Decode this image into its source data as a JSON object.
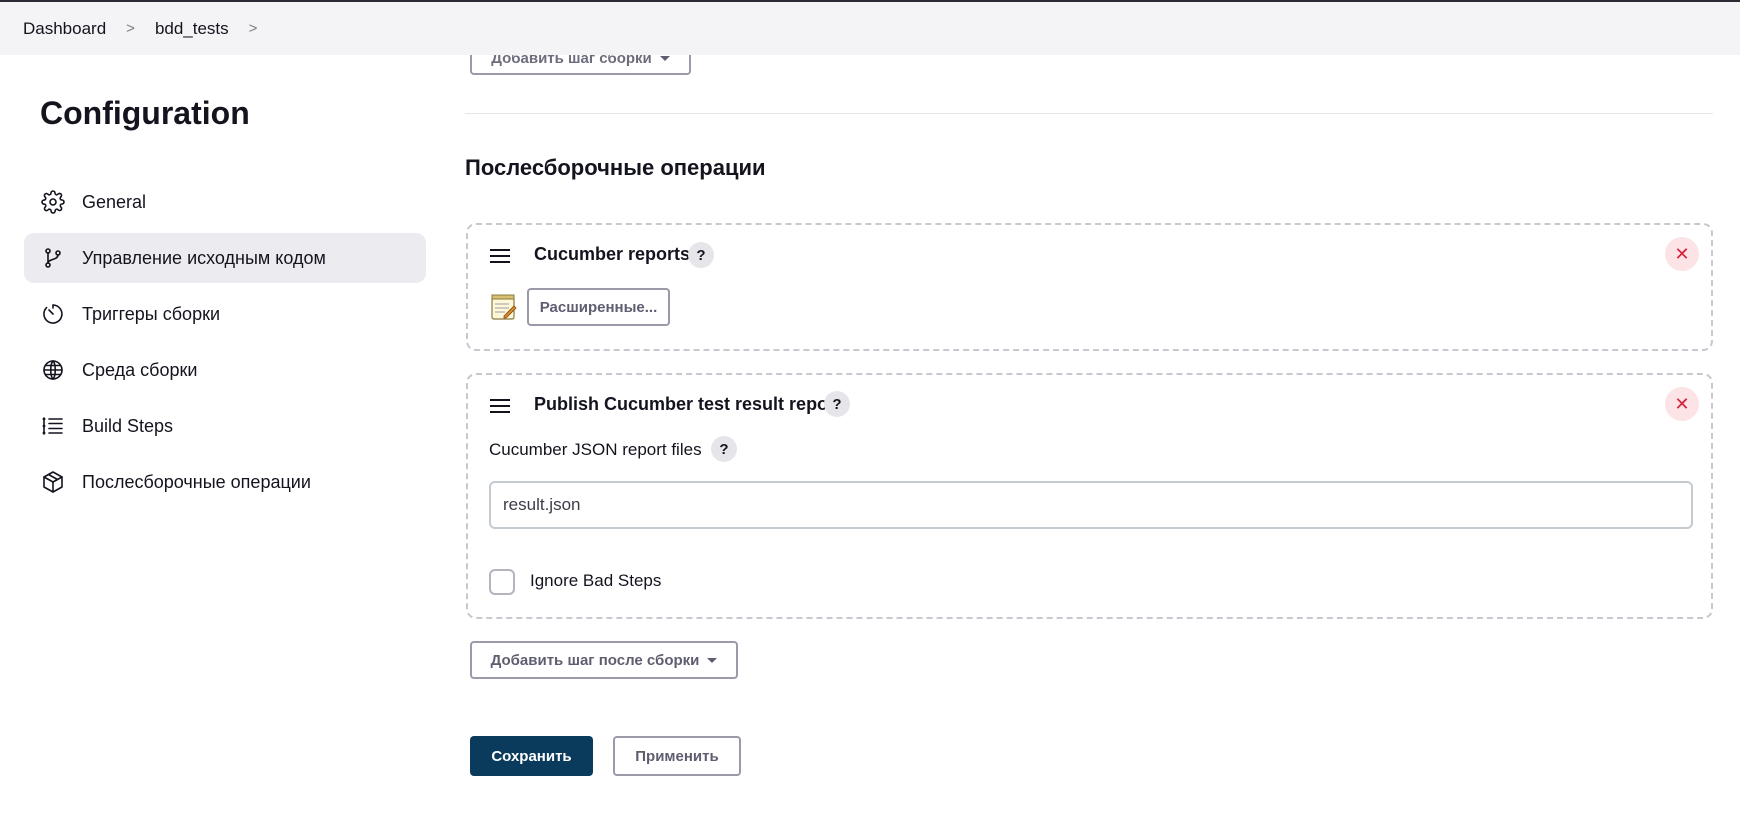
{
  "breadcrumb": {
    "items": [
      "Dashboard",
      "bdd_tests"
    ],
    "separator": ">"
  },
  "sidebar": {
    "title": "Configuration",
    "items": [
      {
        "label": "General",
        "icon": "gear-icon"
      },
      {
        "label": "Управление исходным кодом",
        "icon": "git-branch-icon",
        "active": true
      },
      {
        "label": "Триггеры сборки",
        "icon": "timer-icon"
      },
      {
        "label": "Среда сборки",
        "icon": "globe-icon"
      },
      {
        "label": "Build Steps",
        "icon": "list-steps-icon"
      },
      {
        "label": "Послесборочные операции",
        "icon": "package-icon"
      }
    ]
  },
  "main": {
    "top_button_label": "Добавить шаг сборки",
    "section_title": "Послесборочные операции",
    "cards": [
      {
        "title": "Cucumber reports",
        "help": "?",
        "close": "✕",
        "advanced_label": "Расширенные..."
      },
      {
        "title": "Publish Cucumber test result report",
        "help": "?",
        "close": "✕",
        "field_label": "Cucumber JSON report files",
        "field_help": "?",
        "field_value": "result.json",
        "checkbox_label": "Ignore Bad Steps",
        "checkbox_checked": false
      }
    ],
    "add_post_build_label": "Добавить шаг после сборки",
    "save_label": "Сохранить",
    "apply_label": "Применить"
  },
  "colors": {
    "primary_button": "#0b3b5c",
    "close_icon": "#d6213a",
    "active_nav_bg": "#ececf0"
  }
}
